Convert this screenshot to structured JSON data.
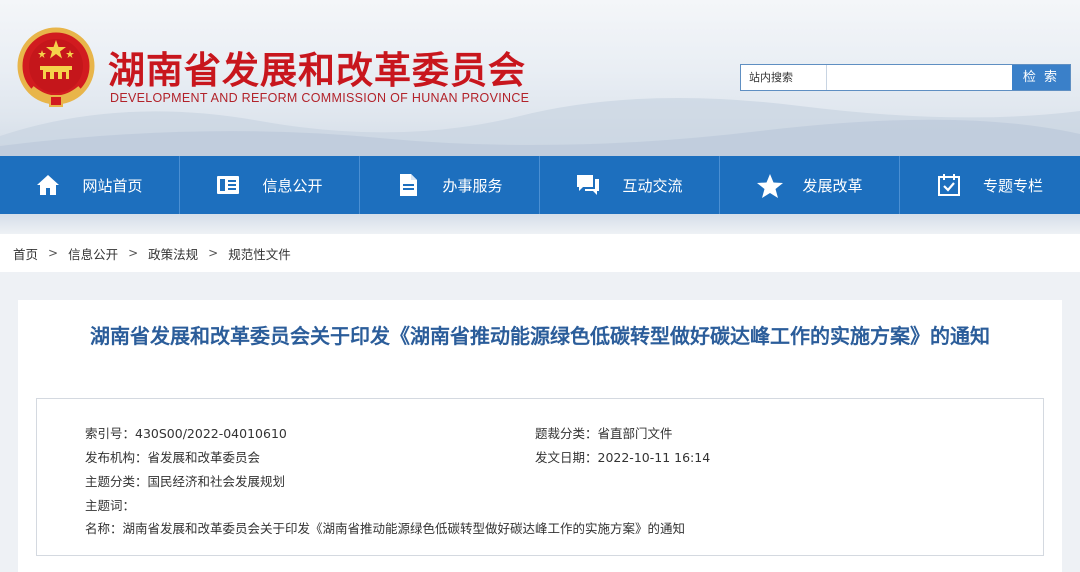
{
  "header": {
    "title": "湖南省发展和改革委员会",
    "subtitle": "DEVELOPMENT AND REFORM COMMISSION OF HUNAN PROVINCE"
  },
  "search": {
    "label": "站内搜索",
    "placeholder": "",
    "button": "检 索"
  },
  "nav": {
    "items": [
      {
        "label": "网站首页",
        "icon": "home-icon"
      },
      {
        "label": "信息公开",
        "icon": "document-list-icon"
      },
      {
        "label": "办事服务",
        "icon": "file-icon"
      },
      {
        "label": "互动交流",
        "icon": "chat-icon"
      },
      {
        "label": "发展改革",
        "icon": "star-icon"
      },
      {
        "label": "专题专栏",
        "icon": "calendar-check-icon"
      }
    ]
  },
  "breadcrumb": {
    "items": [
      "首页",
      "信息公开",
      "政策法规",
      "规范性文件"
    ],
    "separator": ">"
  },
  "document": {
    "title": "湖南省发展和改革委员会关于印发《湖南省推动能源绿色低碳转型做好碳达峰工作的实施方案》的通知",
    "meta": {
      "index_no": "索引号：430S00/2022-04010610",
      "category": "题裁分类：省直部门文件",
      "issuer": "发布机构：省发展和改革委员会",
      "date": "发文日期：2022-10-11 16:14",
      "topic": "主题分类：国民经济和社会发展规划",
      "keywords": "主题词：",
      "name": "名称：湖南省发展和改革委员会关于印发《湖南省推动能源绿色低碳转型做好碳达峰工作的实施方案》的通知"
    }
  },
  "colors": {
    "brand_red": "#c8161d",
    "nav_blue": "#1d6fbe",
    "title_blue": "#2b5d9a"
  }
}
